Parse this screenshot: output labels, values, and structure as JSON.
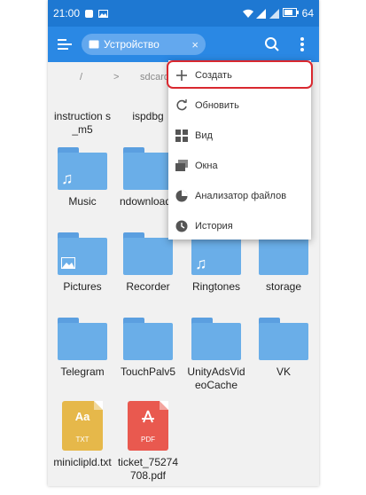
{
  "status": {
    "time": "21:00",
    "battery": "64"
  },
  "toolbar": {
    "location": "Устройство",
    "close": "×"
  },
  "path": {
    "root": "/",
    "chevron": ">",
    "current": "sdcard"
  },
  "menu": {
    "items": [
      {
        "label": "Создать",
        "icon": "plus-icon"
      },
      {
        "label": "Обновить",
        "icon": "refresh-icon"
      },
      {
        "label": "Вид",
        "icon": "grid-icon"
      },
      {
        "label": "Окна",
        "icon": "windows-icon"
      },
      {
        "label": "Анализатор файлов",
        "icon": "pie-chart-icon"
      },
      {
        "label": "История",
        "icon": "clock-icon"
      }
    ]
  },
  "files": {
    "instruction": "instruction s_m5",
    "ispdbg": "ispdbg",
    "music": "Music",
    "ndownloads": "ndownloads",
    "pictures": "Pictures",
    "recorder": "Recorder",
    "ringtones": "Ringtones",
    "storage": "storage",
    "telegram": "Telegram",
    "touchpal": "TouchPalv5",
    "unityads": "UnityAdsVideoCache",
    "vk": "VK",
    "miniclip": "miniclipld.txt",
    "ticket": "ticket_75274708.pdf"
  },
  "file_badges": {
    "txt_big": "Aa",
    "txt_small": "TXT",
    "pdf_small": "PDF"
  },
  "colors": {
    "statusbar": "#1e78d2",
    "toolbar": "#2a88e4",
    "folder": "#6aaee8",
    "txt": "#e6b84a",
    "pdf": "#e9594f",
    "highlight": "#d9282f"
  }
}
